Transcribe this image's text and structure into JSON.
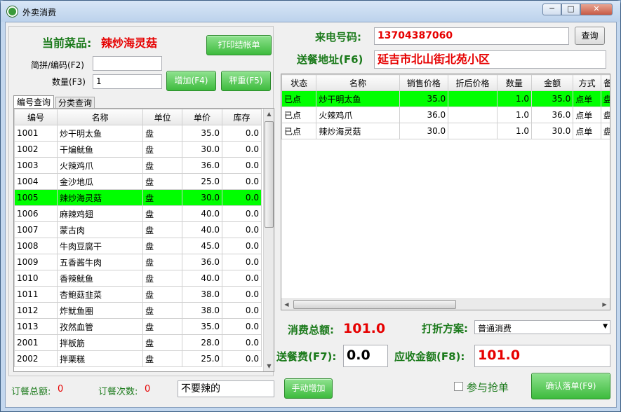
{
  "window": {
    "title": "外卖消费",
    "min": "─",
    "max": "□",
    "close": "✕"
  },
  "left": {
    "current_dish_label": "当前菜品:",
    "current_dish_value": "辣炒海灵菇",
    "print_button": "打印结帐单",
    "code_label": "简拼/编码(F2)",
    "code_value": "",
    "qty_label": "数量(F3)",
    "qty_value": "1",
    "add_button": "增加(F4)",
    "weigh_button": "秤重(F5)",
    "tabs": [
      "编号查询",
      "分类查询"
    ],
    "columns": [
      "编号",
      "名称",
      "单位",
      "单价",
      "库存"
    ],
    "rows": [
      [
        "1001",
        "炒干明太鱼",
        "盘",
        "35.0",
        "0.0"
      ],
      [
        "1002",
        "干煸鱿鱼",
        "盘",
        "30.0",
        "0.0"
      ],
      [
        "1003",
        "火辣鸡爪",
        "盘",
        "36.0",
        "0.0"
      ],
      [
        "1004",
        "金沙地瓜",
        "盘",
        "25.0",
        "0.0"
      ],
      [
        "1005",
        "辣炒海灵菇",
        "盘",
        "30.0",
        "0.0"
      ],
      [
        "1006",
        "麻辣鸡翅",
        "盘",
        "40.0",
        "0.0"
      ],
      [
        "1007",
        "蒙古肉",
        "盘",
        "40.0",
        "0.0"
      ],
      [
        "1008",
        "牛肉豆腐干",
        "盘",
        "45.0",
        "0.0"
      ],
      [
        "1009",
        "五香酱牛肉",
        "盘",
        "36.0",
        "0.0"
      ],
      [
        "1010",
        "香辣鱿鱼",
        "盘",
        "40.0",
        "0.0"
      ],
      [
        "1011",
        "杏鲍菇韭菜",
        "盘",
        "38.0",
        "0.0"
      ],
      [
        "1012",
        "炸鱿鱼圈",
        "盘",
        "38.0",
        "0.0"
      ],
      [
        "1013",
        "孜然血管",
        "盘",
        "35.0",
        "0.0"
      ],
      [
        "2001",
        "拌板筋",
        "盘",
        "28.0",
        "0.0"
      ],
      [
        "2002",
        "拌栗糕",
        "盘",
        "25.0",
        "0.0"
      ]
    ],
    "highlight_row": 4
  },
  "right": {
    "phone_label": "来电号码:",
    "phone_value": "13704387060",
    "search_button": "查询",
    "address_label": "送餐地址(F6)",
    "address_value": "延吉市北山街北苑小区",
    "columns": [
      "状态",
      "名称",
      "销售价格",
      "折后价格",
      "数量",
      "金额",
      "方式",
      "备"
    ],
    "rows": [
      [
        "已点",
        "炒干明太鱼",
        "35.0",
        "",
        "1.0",
        "35.0",
        "点单",
        "盘"
      ],
      [
        "已点",
        "火辣鸡爪",
        "36.0",
        "",
        "1.0",
        "36.0",
        "点单",
        "盘"
      ],
      [
        "已点",
        "辣炒海灵菇",
        "30.0",
        "",
        "1.0",
        "30.0",
        "点单",
        "盘"
      ]
    ],
    "highlight_row": 0,
    "total_label": "消费总额:",
    "total_value": "101.0",
    "discount_label": "打折方案:",
    "discount_value": "普通消费",
    "delivery_label": "送餐费(F7):",
    "delivery_value": "0.0",
    "due_label": "应收金额(F8):",
    "due_value": "101.0",
    "grab_label": "参与抢单",
    "confirm_button": "确认落单(F9)"
  },
  "bottom": {
    "order_total_label": "订餐总额:",
    "order_total_value": "0",
    "order_count_label": "订餐次数:",
    "order_count_value": "0",
    "note_value": "不要辣的",
    "manual_add_button": "手动增加"
  },
  "colors": {
    "highlight": "#00ff00",
    "accent_red": "#e60000",
    "label_green": "#1b7a1b"
  }
}
